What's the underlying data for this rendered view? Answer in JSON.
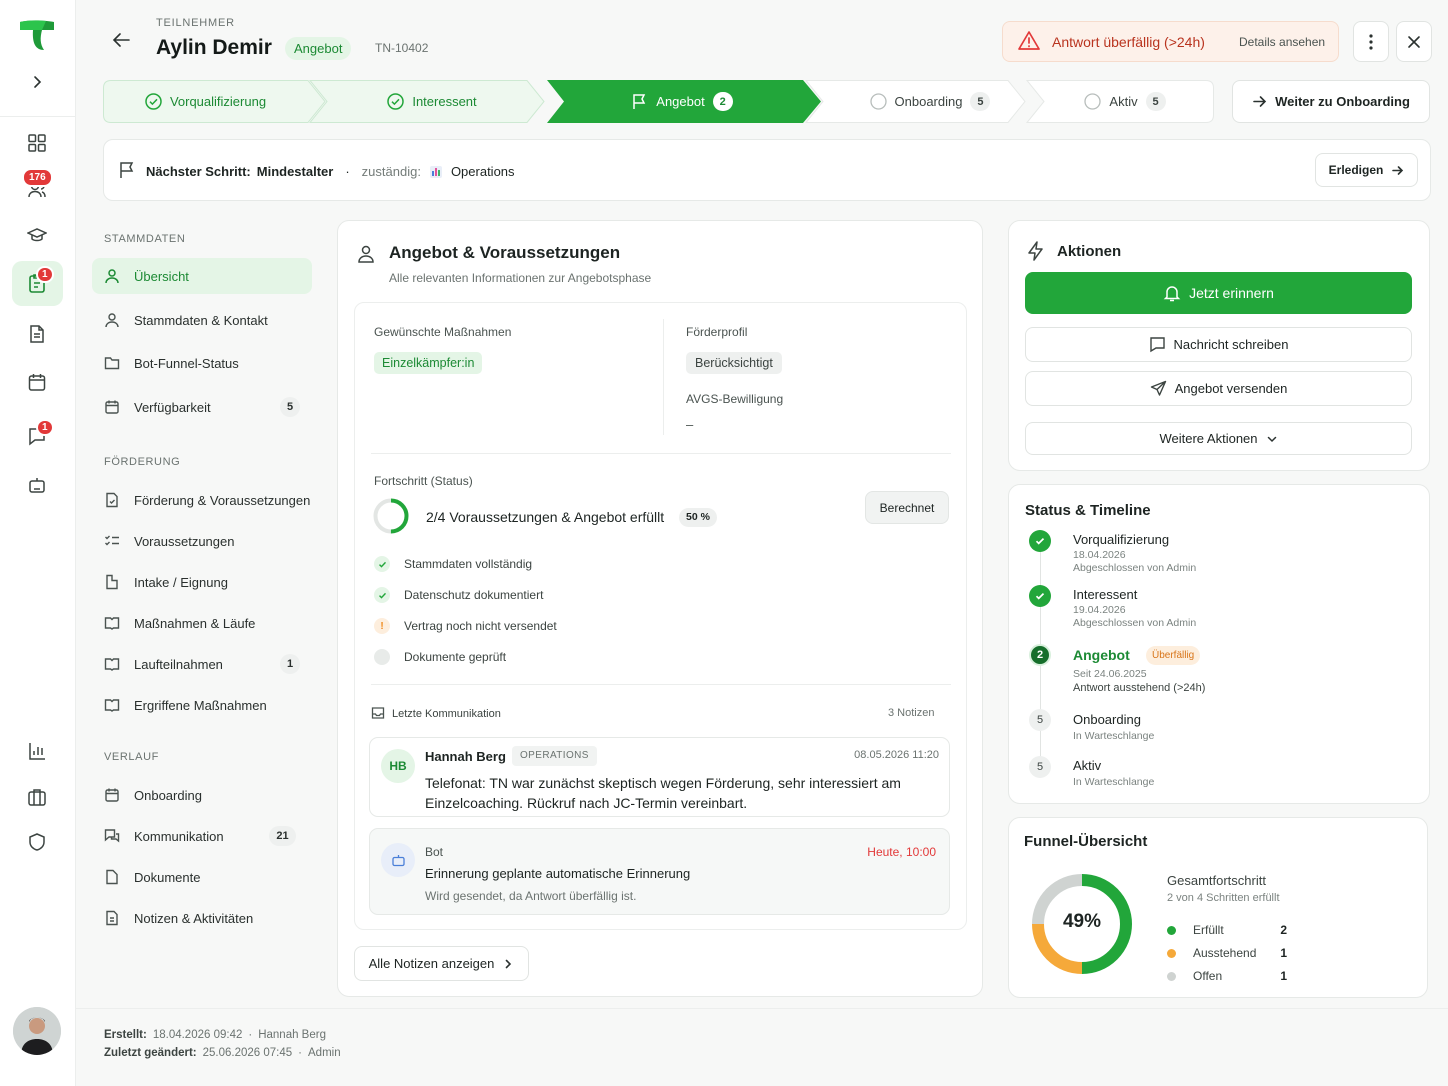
{
  "header": {
    "overline": "TEILNEHMER",
    "name": "Aylin Demir",
    "status_badge": "Angebot",
    "id": "TN-10402",
    "alert_text": "Antwort überfällig (>24h)",
    "alert_link": "Details ansehen"
  },
  "rail": {
    "badge_users": "176",
    "badge_tasks": "1",
    "badge_messages": "1"
  },
  "stages": [
    {
      "label": "Vorqualifizierung",
      "state": "done",
      "count": ""
    },
    {
      "label": "Interessent",
      "state": "done",
      "count": ""
    },
    {
      "label": "Angebot",
      "state": "current",
      "count": "2"
    },
    {
      "label": "Onboarding",
      "state": "open",
      "count": "5"
    },
    {
      "label": "Aktiv",
      "state": "open",
      "count": "5"
    }
  ],
  "next_stage_button": "Weiter zu Onboarding",
  "next_step": {
    "label": "Nächster Schritt:",
    "value": "Mindestalter",
    "separator": "·",
    "owner_label": "zuständig:",
    "owner": "Operations",
    "action": "Erledigen"
  },
  "sidebar": {
    "sections": [
      {
        "title": "STAMMDATEN",
        "items": [
          {
            "label": "Übersicht",
            "count": ""
          },
          {
            "label": "Stammdaten & Kontakt",
            "count": ""
          },
          {
            "label": "Bot-Funnel-Status",
            "count": ""
          },
          {
            "label": "Verfügbarkeit",
            "count": "5"
          }
        ]
      },
      {
        "title": "FÖRDERUNG",
        "items": [
          {
            "label": "Förderung & Voraussetzungen",
            "count": ""
          },
          {
            "label": "Voraussetzungen",
            "count": ""
          },
          {
            "label": "Intake / Eignung",
            "count": ""
          },
          {
            "label": "Maßnahmen & Läufe",
            "count": ""
          },
          {
            "label": "Laufteilnahmen",
            "count": "1"
          },
          {
            "label": "Ergriffene Maßnahmen",
            "count": ""
          }
        ]
      },
      {
        "title": "VERLAUF",
        "items": [
          {
            "label": "Onboarding",
            "count": ""
          },
          {
            "label": "Kommunikation",
            "count": "21"
          },
          {
            "label": "Dokumente",
            "count": ""
          },
          {
            "label": "Notizen & Aktivitäten",
            "count": ""
          }
        ]
      }
    ]
  },
  "main": {
    "title": "Angebot & Voraussetzungen",
    "subtitle": "Alle relevanten Informationen zur Angebotsphase",
    "measures_label": "Gewünschte Maßnahmen",
    "measures_tag": "Einzelkämpfer:in",
    "profile_label": "Förderprofil",
    "profile_tag": "Berücksichtigt",
    "avgs_label": "AVGS-Bewilligung",
    "avgs_value": "–",
    "progress_label": "Fortschritt (Status)",
    "progress_text": "2/4 Voraussetzungen & Angebot erfüllt",
    "progress_pct": "50 %",
    "progress_value": 0.5,
    "progress_button": "Berechnet",
    "checklist": [
      {
        "label": "Stammdaten vollständig",
        "state": "done"
      },
      {
        "label": "Datenschutz dokumentiert",
        "state": "done"
      },
      {
        "label": "Vertrag noch nicht versendet",
        "state": "warn"
      },
      {
        "label": "Dokumente geprüft",
        "state": "open"
      }
    ],
    "comm_label": "Letzte Kommunikation",
    "comm_count": "3 Notizen",
    "note1": {
      "initials": "HB",
      "author": "Hannah Berg",
      "tag": "OPERATIONS",
      "time": "08.05.2026 11:20",
      "text": "Telefonat: TN war zunächst skeptisch wegen Förderung, sehr interessiert am Einzelcoaching. Rückruf nach JC-Termin vereinbart."
    },
    "note2": {
      "author": "Bot",
      "time": "Heute, 10:00",
      "title": "Erinnerung geplante automatische Erinnerung",
      "text": "Wird gesendet, da Antwort überfällig ist."
    },
    "all_notes_button": "Alle Notizen anzeigen"
  },
  "actions": {
    "title": "Aktionen",
    "primary": "Jetzt erinnern",
    "message": "Nachricht schreiben",
    "send_offer": "Angebot versenden",
    "more": "Weitere Aktionen"
  },
  "timeline": {
    "title": "Status & Timeline",
    "items": [
      {
        "marker": "",
        "title": "Vorqualifizierung",
        "line1": "18.04.2026",
        "line2": "Abgeschlossen von Admin",
        "state": "done",
        "badge": ""
      },
      {
        "marker": "",
        "title": "Interessent",
        "line1": "19.04.2026",
        "line2": "Abgeschlossen von Admin",
        "state": "done",
        "badge": ""
      },
      {
        "marker": "2",
        "title": "Angebot",
        "line1": "Seit 24.06.2025",
        "line2": "Antwort ausstehend (>24h)",
        "state": "current",
        "badge": "Überfällig"
      },
      {
        "marker": "5",
        "title": "Onboarding",
        "line1": "In Warteschlange",
        "line2": "",
        "state": "open",
        "badge": ""
      },
      {
        "marker": "5",
        "title": "Aktiv",
        "line1": "In Warteschlange",
        "line2": "",
        "state": "open",
        "badge": ""
      }
    ]
  },
  "funnel": {
    "title": "Funnel-Übersicht",
    "percent": "49%",
    "heading": "Gesamtfortschritt",
    "sub": "2 von 4 Schritten erfüllt",
    "legend": [
      {
        "label": "Erfüllt",
        "value": "2",
        "color": "#22a63a"
      },
      {
        "label": "Ausstehend",
        "value": "1",
        "color": "#f5a93a"
      },
      {
        "label": "Offen",
        "value": "1",
        "color": "#cfd3d1"
      }
    ]
  },
  "footer": {
    "created_label": "Erstellt:",
    "created_value": "18.04.2026 09:42",
    "created_by": "Hannah Berg",
    "changed_label": "Zuletzt geändert:",
    "changed_value": "25.06.2026 07:45",
    "changed_by": "Admin",
    "sep": "·"
  },
  "colors": {
    "brand": "#22a63a",
    "danger": "#e23939",
    "warning": "#f5a93a"
  }
}
